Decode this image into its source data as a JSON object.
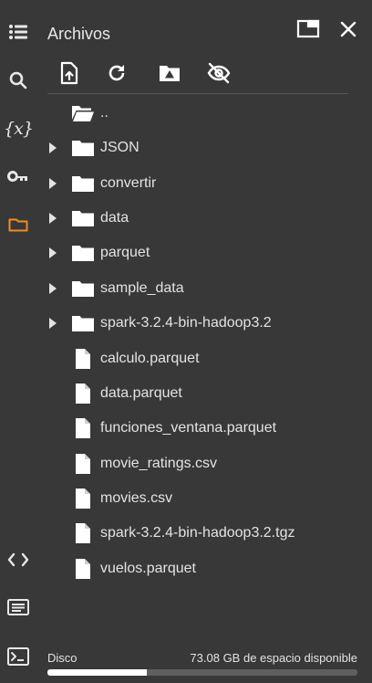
{
  "panel": {
    "title": "Archivos"
  },
  "tree": {
    "items": [
      {
        "label": "..",
        "kind": "parent"
      },
      {
        "label": "JSON",
        "kind": "folder"
      },
      {
        "label": "convertir",
        "kind": "folder"
      },
      {
        "label": "data",
        "kind": "folder"
      },
      {
        "label": "parquet",
        "kind": "folder"
      },
      {
        "label": "sample_data",
        "kind": "folder"
      },
      {
        "label": "spark-3.2.4-bin-hadoop3.2",
        "kind": "folder"
      },
      {
        "label": "calculo.parquet",
        "kind": "file"
      },
      {
        "label": "data.parquet",
        "kind": "file"
      },
      {
        "label": "funciones_ventana.parquet",
        "kind": "file"
      },
      {
        "label": "movie_ratings.csv",
        "kind": "file"
      },
      {
        "label": "movies.csv",
        "kind": "file"
      },
      {
        "label": "spark-3.2.4-bin-hadoop3.2.tgz",
        "kind": "file"
      },
      {
        "label": "vuelos.parquet",
        "kind": "file"
      }
    ]
  },
  "sidebar": {
    "variables_label": "{x}",
    "active_item": "files",
    "accent_color": "#f28b1e"
  },
  "footer": {
    "disk_label": "Disco",
    "free_space": "73.08 GB de espacio disponible",
    "usage_fraction": 0.32
  }
}
